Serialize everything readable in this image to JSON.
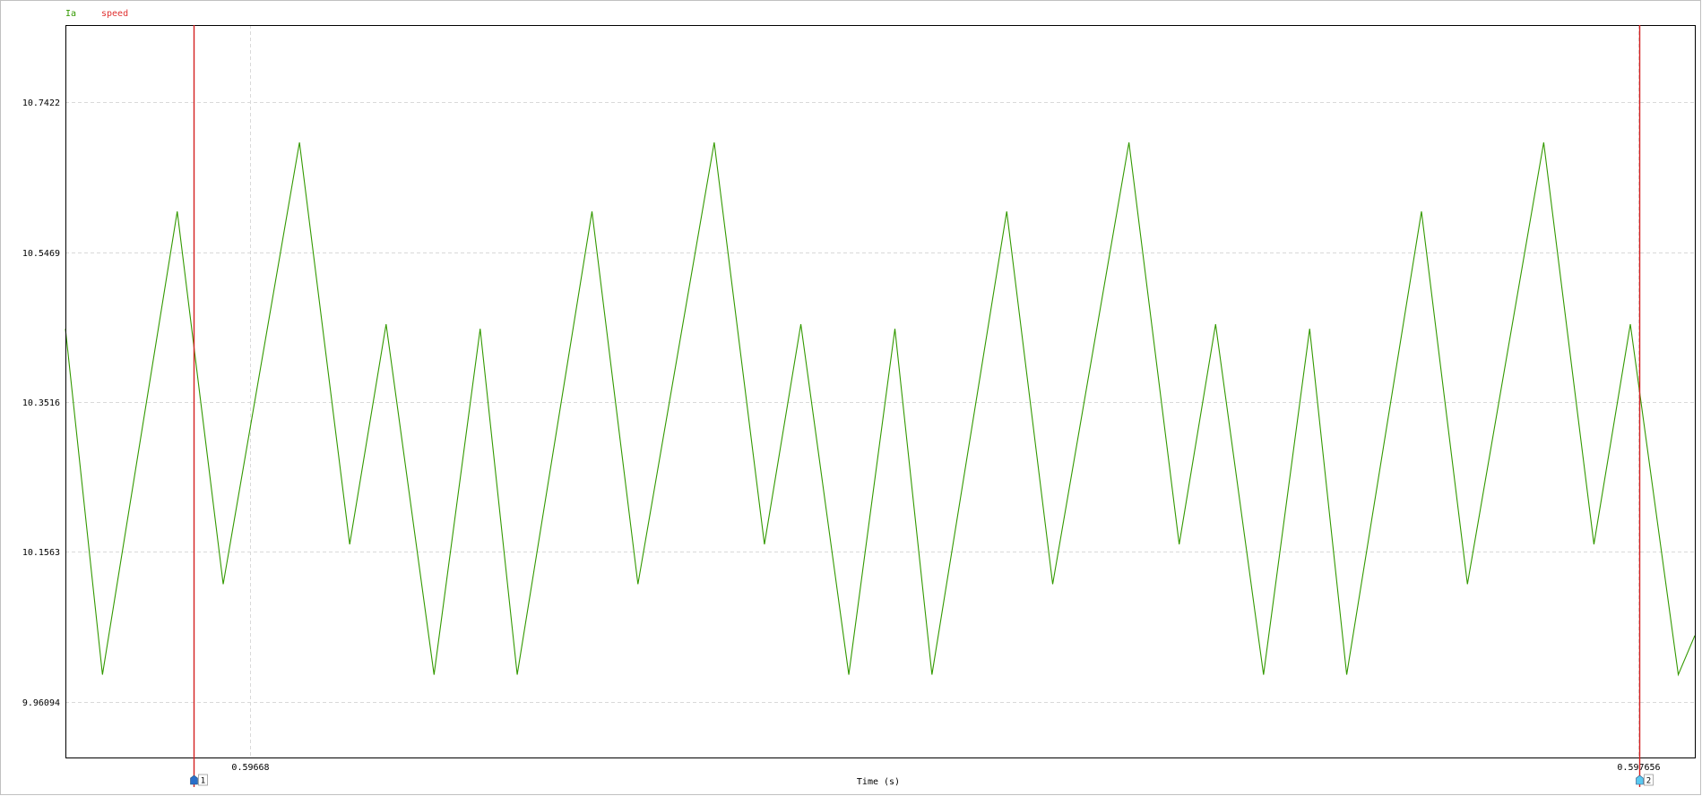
{
  "chart_data": {
    "type": "line",
    "title": "",
    "xlabel": "Time (s)",
    "ylabel": "",
    "legend": {
      "placement": "top-left",
      "entries": [
        {
          "name": "Ia",
          "color": "#339900"
        },
        {
          "name": "speed",
          "color": "#e03030"
        }
      ]
    },
    "grid": true,
    "ylim": [
      9.888,
      10.843
    ],
    "yticks": [
      {
        "value": 9.96094,
        "label": "9.96094"
      },
      {
        "value": 10.1563,
        "label": "10.1563"
      },
      {
        "value": 10.3516,
        "label": "10.3516"
      },
      {
        "value": 10.5469,
        "label": "10.5469"
      },
      {
        "value": 10.7422,
        "label": "10.7422"
      }
    ],
    "xlim": [
      0.59655,
      0.597696
    ],
    "xticks": [
      {
        "value": 0.59668,
        "label": "0.59668"
      },
      {
        "value": 0.597656,
        "label": "0.597656"
      }
    ],
    "cursors": [
      {
        "id": "1",
        "label": "1",
        "x": 0.59664,
        "color": "#d42020",
        "marker_color": "#2a6fc9"
      },
      {
        "id": "2",
        "label": "2",
        "x": 0.597657,
        "color": "#d42020",
        "marker_color": "#5ac8f0"
      }
    ],
    "series": [
      {
        "name": "Ia",
        "color": "#339900",
        "period": 0.0002917,
        "x_start": 0.59655,
        "shape": [
          {
            "phase": 0.0,
            "y": 10.447
          },
          {
            "phase": 0.0893,
            "y": 9.996
          },
          {
            "phase": 0.2696,
            "y": 10.6
          },
          {
            "phase": 0.3804,
            "y": 10.114
          },
          {
            "phase": 0.5643,
            "y": 10.69
          },
          {
            "phase": 0.6854,
            "y": 10.166
          },
          {
            "phase": 0.7732,
            "y": 10.453
          },
          {
            "phase": 0.8888,
            "y": 9.996
          },
          {
            "phase": 1.0,
            "y": 10.447
          }
        ],
        "end": {
          "x": 0.597696,
          "y": 10.047
        }
      }
    ]
  }
}
